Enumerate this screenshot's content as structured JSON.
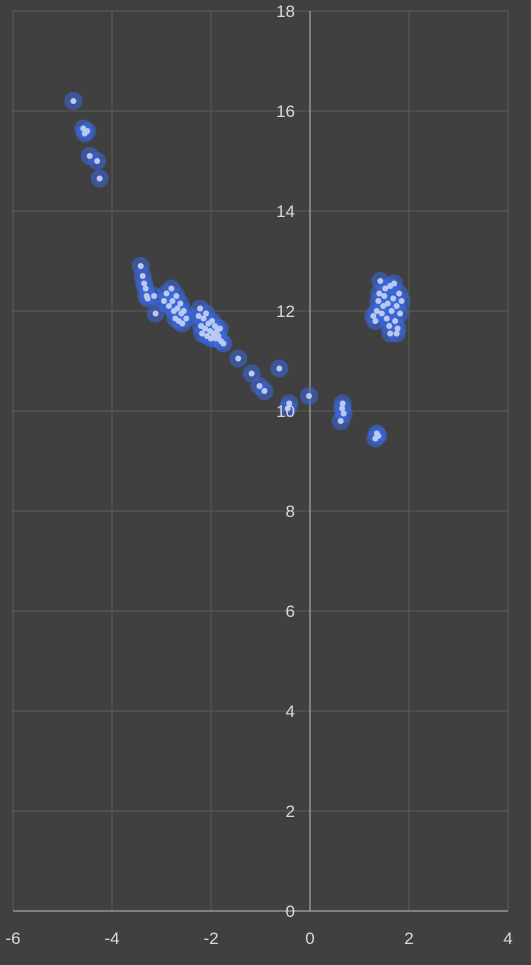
{
  "chart_data": {
    "type": "scatter",
    "title": "",
    "xlabel": "",
    "ylabel": "",
    "xlim": [
      -6,
      4
    ],
    "ylim": [
      0,
      18
    ],
    "x_ticks": [
      "-6",
      "-4",
      "-2",
      "0",
      "2",
      "4"
    ],
    "y_ticks": [
      "0",
      "2",
      "4",
      "6",
      "8",
      "10",
      "12",
      "14",
      "16",
      "18"
    ],
    "grid": true,
    "legend": "none",
    "colors": {
      "background": "#404040",
      "grid": "#5c5c5c",
      "axis": "#a6a6a6",
      "point": "#b9c9f0",
      "glow": "#3a67e0",
      "text": "#d9d9d9"
    },
    "series": [
      {
        "points": [
          [
            -4.78,
            16.2
          ],
          [
            -4.58,
            15.65
          ],
          [
            -4.55,
            15.55
          ],
          [
            -4.5,
            15.6
          ],
          [
            -4.45,
            15.1
          ],
          [
            -4.3,
            15.0
          ],
          [
            -4.25,
            14.65
          ],
          [
            -3.42,
            12.9
          ],
          [
            -3.38,
            12.7
          ],
          [
            -3.35,
            12.55
          ],
          [
            -3.32,
            12.45
          ],
          [
            -3.3,
            12.3
          ],
          [
            -3.28,
            12.25
          ],
          [
            -3.15,
            12.3
          ],
          [
            -3.12,
            11.95
          ],
          [
            -2.95,
            12.2
          ],
          [
            -2.9,
            12.35
          ],
          [
            -2.85,
            12.1
          ],
          [
            -2.8,
            12.45
          ],
          [
            -2.78,
            12.2
          ],
          [
            -2.75,
            12.0
          ],
          [
            -2.72,
            11.85
          ],
          [
            -2.7,
            12.3
          ],
          [
            -2.68,
            12.05
          ],
          [
            -2.65,
            11.8
          ],
          [
            -2.62,
            12.15
          ],
          [
            -2.6,
            11.95
          ],
          [
            -2.58,
            11.75
          ],
          [
            -2.55,
            12.0
          ],
          [
            -2.5,
            11.85
          ],
          [
            -2.25,
            11.9
          ],
          [
            -2.22,
            12.05
          ],
          [
            -2.2,
            11.7
          ],
          [
            -2.18,
            11.55
          ],
          [
            -2.15,
            11.85
          ],
          [
            -2.12,
            11.65
          ],
          [
            -2.1,
            11.95
          ],
          [
            -2.08,
            11.5
          ],
          [
            -2.05,
            11.75
          ],
          [
            -2.02,
            11.6
          ],
          [
            -2.0,
            11.45
          ],
          [
            -1.98,
            11.8
          ],
          [
            -1.95,
            11.55
          ],
          [
            -1.92,
            11.7
          ],
          [
            -1.9,
            11.45
          ],
          [
            -1.88,
            11.6
          ],
          [
            -1.85,
            11.5
          ],
          [
            -1.82,
            11.65
          ],
          [
            -1.8,
            11.4
          ],
          [
            -1.75,
            11.35
          ],
          [
            -1.45,
            11.05
          ],
          [
            -1.18,
            10.75
          ],
          [
            -1.02,
            10.5
          ],
          [
            -0.92,
            10.4
          ],
          [
            -0.62,
            10.85
          ],
          [
            -0.42,
            10.15
          ],
          [
            -0.45,
            10.05
          ],
          [
            -0.02,
            10.3
          ],
          [
            0.62,
            9.8
          ],
          [
            0.65,
            10.05
          ],
          [
            0.66,
            10.15
          ],
          [
            0.68,
            9.95
          ],
          [
            1.32,
            9.45
          ],
          [
            1.35,
            9.55
          ],
          [
            1.38,
            9.5
          ],
          [
            1.28,
            11.9
          ],
          [
            1.32,
            11.8
          ],
          [
            1.35,
            12.0
          ],
          [
            1.38,
            12.2
          ],
          [
            1.4,
            12.35
          ],
          [
            1.42,
            12.6
          ],
          [
            1.45,
            11.95
          ],
          [
            1.48,
            12.1
          ],
          [
            1.5,
            12.3
          ],
          [
            1.52,
            12.45
          ],
          [
            1.55,
            11.85
          ],
          [
            1.57,
            12.15
          ],
          [
            1.6,
            11.7
          ],
          [
            1.62,
            11.55
          ],
          [
            1.65,
            12.0
          ],
          [
            1.68,
            12.25
          ],
          [
            1.7,
            12.55
          ],
          [
            1.72,
            11.8
          ],
          [
            1.75,
            12.1
          ],
          [
            1.77,
            11.65
          ],
          [
            1.8,
            12.35
          ],
          [
            1.82,
            11.95
          ],
          [
            1.85,
            12.2
          ],
          [
            1.75,
            11.55
          ],
          [
            1.62,
            12.5
          ]
        ]
      }
    ]
  }
}
